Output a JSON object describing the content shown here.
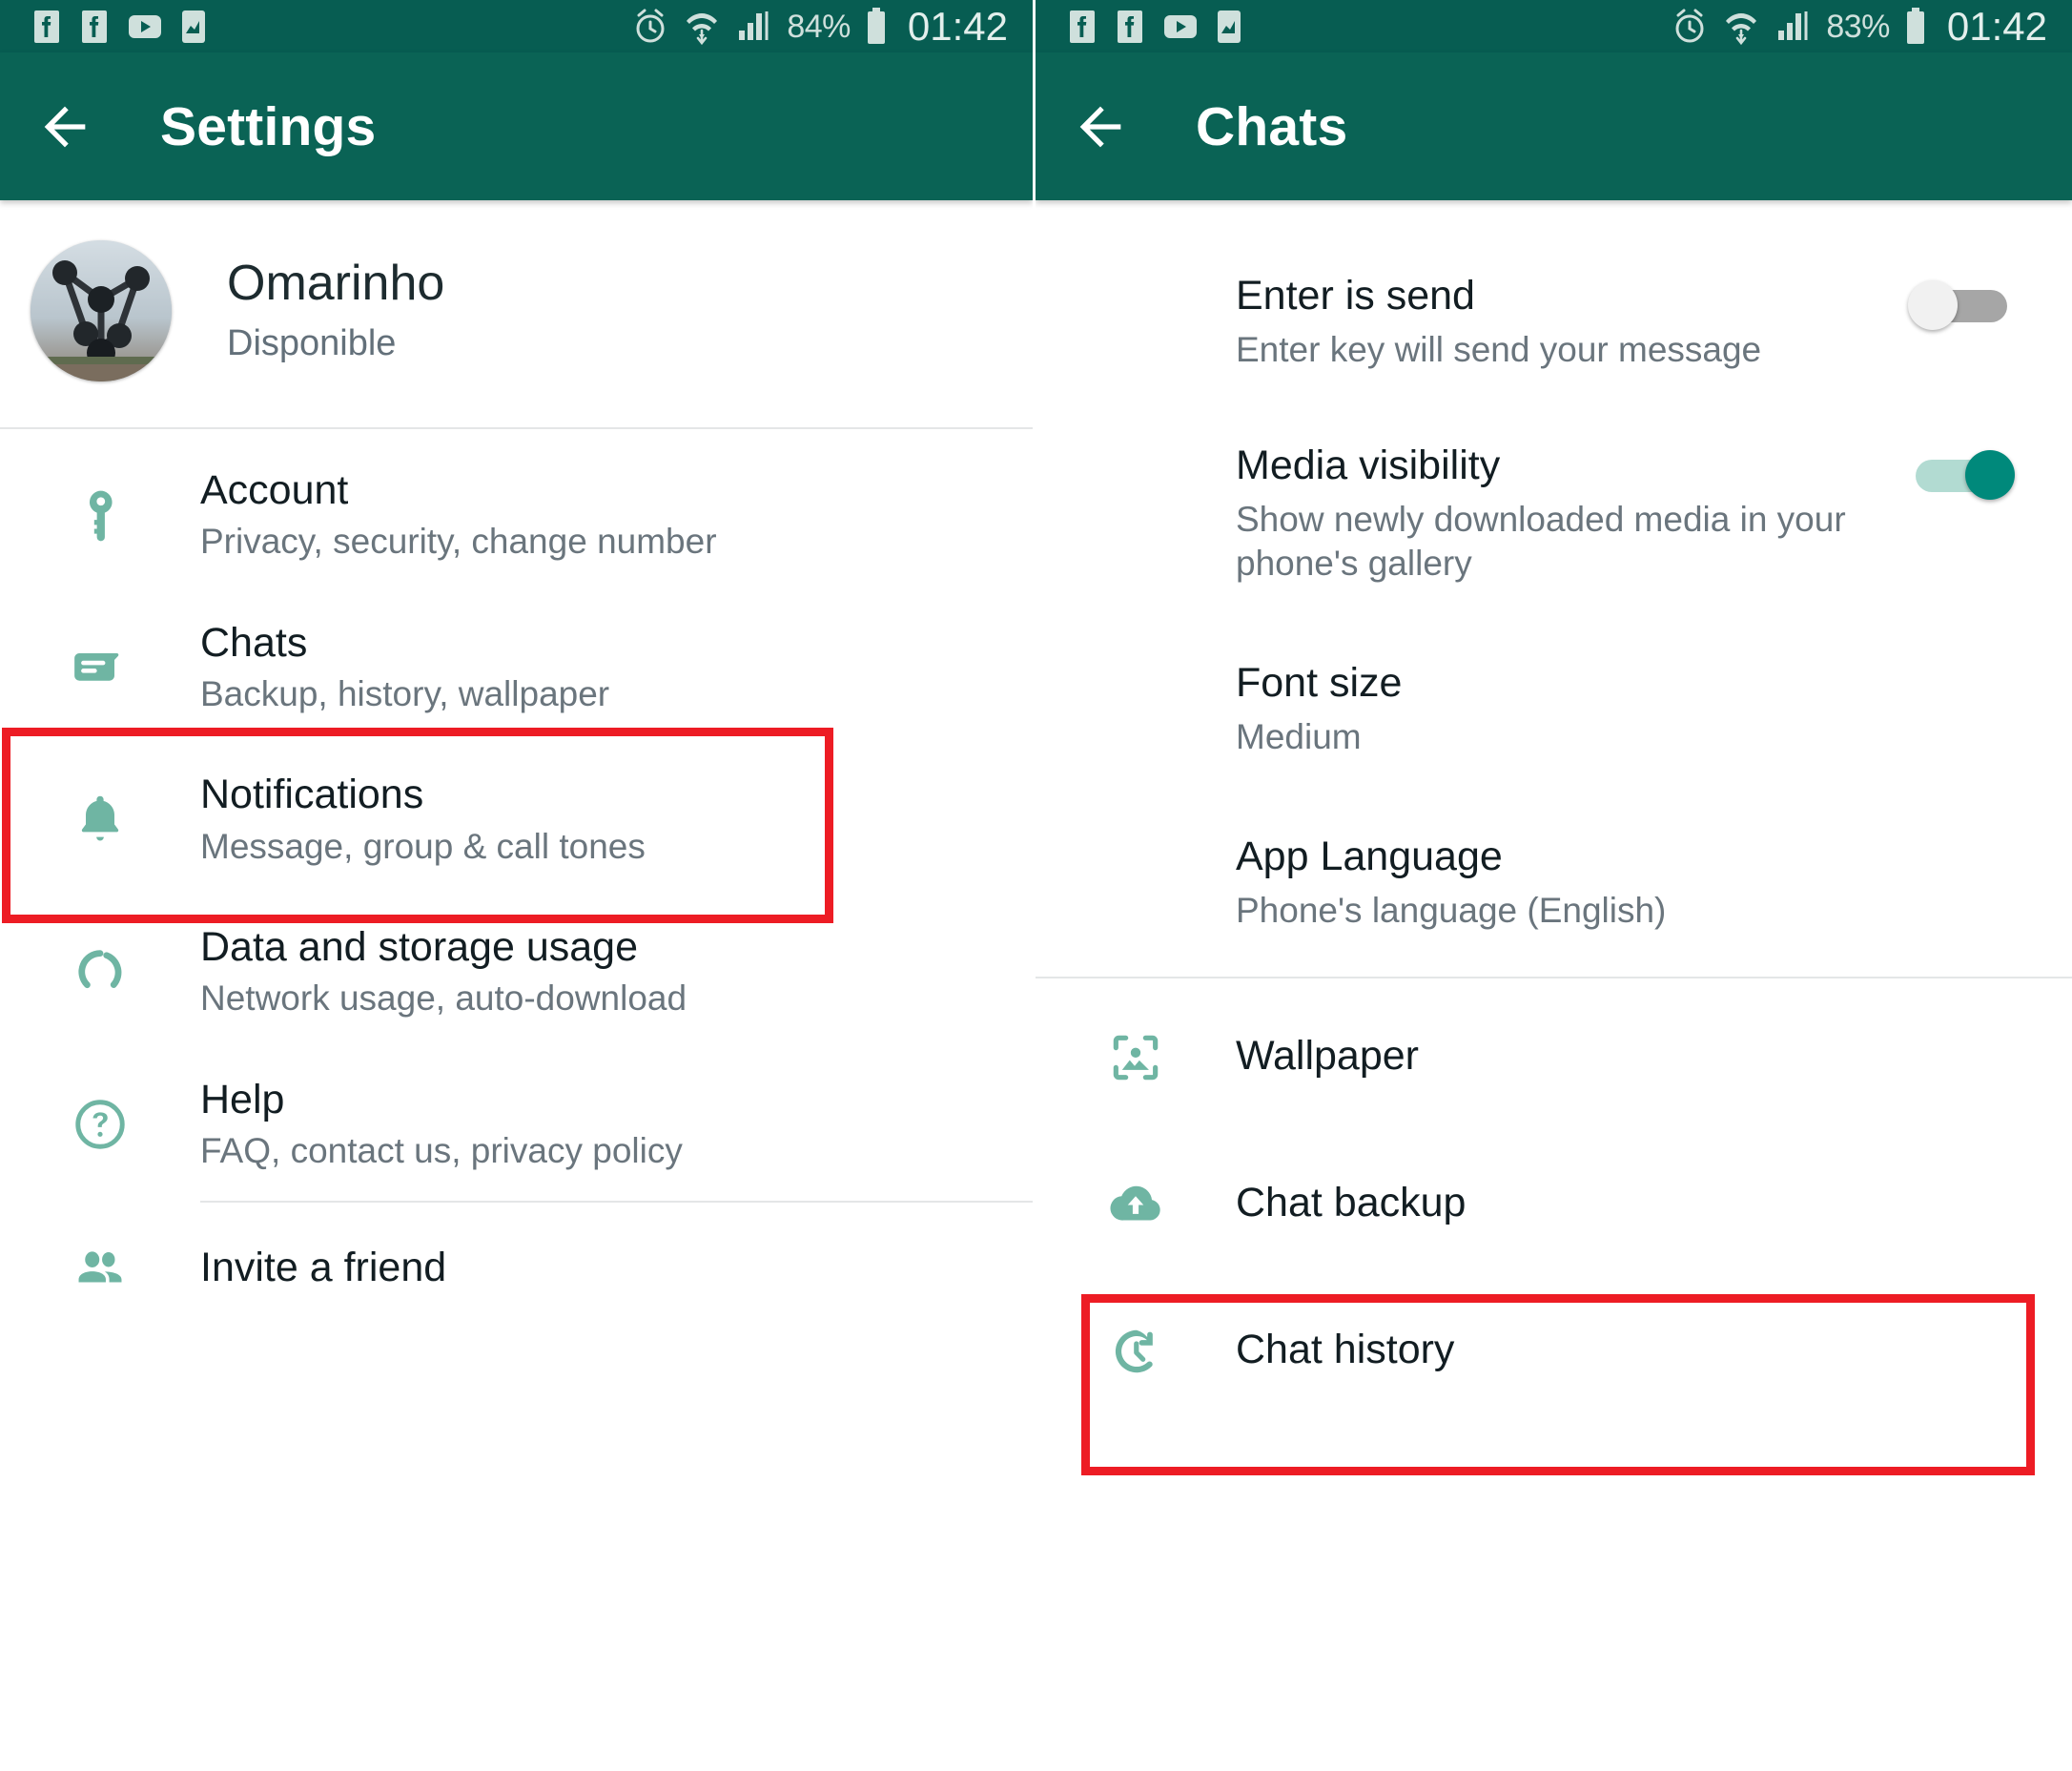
{
  "left": {
    "status_bar": {
      "battery_percent": "84%",
      "clock": "01:42",
      "icons": [
        "facebook-icon",
        "facebook-icon",
        "youtube-icon",
        "app-icon",
        "alarm-icon",
        "wifi-icon",
        "signal-icon",
        "battery-icon"
      ]
    },
    "appbar": {
      "title": "Settings",
      "back_label": "back-arrow-icon"
    },
    "profile": {
      "name": "Omarinho",
      "status": "Disponible",
      "avatar_alt": "atomium-photo"
    },
    "items": [
      {
        "icon": "key-icon",
        "title": "Account",
        "subtitle": "Privacy, security, change number"
      },
      {
        "icon": "chat-bubble-icon",
        "title": "Chats",
        "subtitle": "Backup, history, wallpaper"
      },
      {
        "icon": "bell-icon",
        "title": "Notifications",
        "subtitle": "Message, group & call tones"
      },
      {
        "icon": "data-usage-icon",
        "title": "Data and storage usage",
        "subtitle": "Network usage, auto-download"
      },
      {
        "icon": "help-circle-icon",
        "title": "Help",
        "subtitle": "FAQ, contact us, privacy policy"
      }
    ],
    "footer_item": {
      "icon": "people-icon",
      "title": "Invite a friend"
    }
  },
  "right": {
    "status_bar": {
      "battery_percent": "83%",
      "clock": "01:42",
      "icons": [
        "facebook-icon",
        "facebook-icon",
        "youtube-icon",
        "app-icon",
        "alarm-icon",
        "wifi-icon",
        "signal-icon",
        "battery-icon"
      ]
    },
    "appbar": {
      "title": "Chats",
      "back_label": "back-arrow-icon"
    },
    "toggle_items": [
      {
        "title": "Enter is send",
        "subtitle": "Enter key will send your message",
        "state": "off"
      },
      {
        "title": "Media visibility",
        "subtitle": "Show newly downloaded media in your phone's gallery",
        "state": "on"
      }
    ],
    "value_items": [
      {
        "title": "Font size",
        "subtitle": "Medium"
      },
      {
        "title": "App Language",
        "subtitle": "Phone's language (English)"
      }
    ],
    "icon_items": [
      {
        "icon": "image-frame-icon",
        "title": "Wallpaper"
      },
      {
        "icon": "cloud-upload-icon",
        "title": "Chat backup"
      },
      {
        "icon": "history-clock-icon",
        "title": "Chat history"
      }
    ]
  },
  "colors": {
    "appbar_green": "#0A6355",
    "statusbar_green": "#075D52",
    "accent_teal": "#6FB5A3",
    "toggle_on": "#00897B",
    "highlight_red": "#ED1C24",
    "title_text": "#121D22",
    "subtitle_text": "#6A757D"
  }
}
